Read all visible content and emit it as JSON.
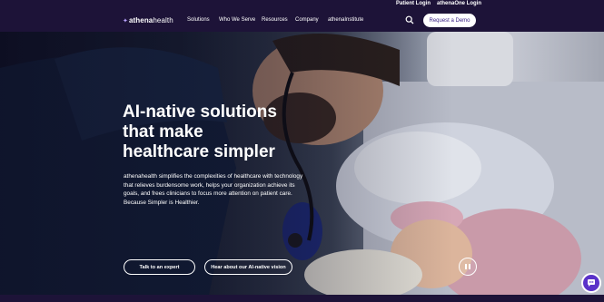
{
  "utility_nav": {
    "patient_login": "Patient Login",
    "athenaone_login": "athenaOne Login"
  },
  "logo": {
    "part1": "athena",
    "part2": "health"
  },
  "nav": {
    "items": [
      "Solutions",
      "Who We Serve",
      "Resources",
      "Company",
      "athenaInstitute"
    ],
    "cta": "Request a Demo"
  },
  "hero": {
    "headline_line1": "AI-native solutions",
    "headline_line2": "that make",
    "headline_line3": "healthcare simpler",
    "body": "athenahealth simplifies the complexities of healthcare with technology that relieves burdensome work, helps your organization achieve its goals, and frees clinicians to focus more attention on patient care. Because Simpler is Healthier.",
    "cta_primary": "Talk to an expert",
    "cta_secondary": "Hear about our AI-native vision"
  },
  "colors": {
    "brand_dark": "#1d1338",
    "brand_purple": "#5a32c9",
    "button_text": "#3b2287"
  },
  "icons": [
    "search-icon",
    "pause-icon",
    "chat-icon",
    "leaf-logo-icon"
  ]
}
